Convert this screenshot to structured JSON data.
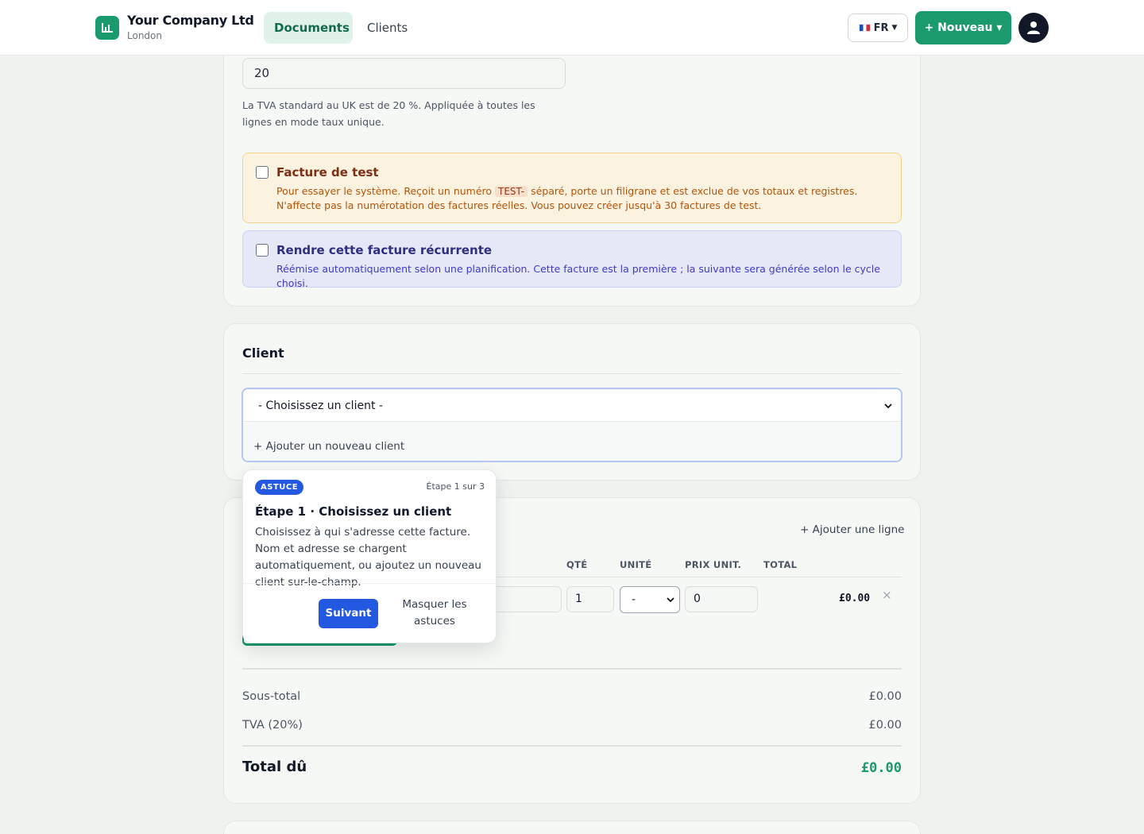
{
  "header": {
    "company_name": "Your Company Ltd",
    "company_city": "London",
    "tabs": [
      {
        "label": "Documents",
        "active": true
      },
      {
        "label": "Clients",
        "active": false
      }
    ],
    "language": "FR",
    "language_flag": "flag-fr-icon",
    "new_button": "+ Nouveau ▾"
  },
  "vat": {
    "value": "20",
    "help": "La TVA standard au UK est de 20 %. Appliquée à toutes les lignes en mode taux unique."
  },
  "test_invoice": {
    "title": "Facture de test",
    "desc_before": "Pour essayer le système. Reçoit un numéro ",
    "code": "TEST-",
    "desc_after": " séparé, porte un filigrane et est exclue de vos totaux et registres. N'affecte pas la numérotation des factures réelles. Vous pouvez créer jusqu'à 30 factures de test.",
    "checked": false
  },
  "recurring": {
    "title": "Rendre cette facture récurrente",
    "desc": "Réémise automatiquement selon une planification. Cette facture est la première ; la suivante sera générée selon le cycle choisi.",
    "checked": false
  },
  "client": {
    "section_title": "Client",
    "select_value": "- Choisissez un client -",
    "add_new": "+ Ajouter un nouveau client"
  },
  "lines": {
    "add_line": "+ Ajouter une ligne",
    "columns": [
      "QTÉ",
      "UNITÉ",
      "PRIX UNIT.",
      "TOTAL"
    ],
    "rows": [
      {
        "qty": "1",
        "unit": "-",
        "price": "0",
        "total": "£0.00"
      }
    ],
    "delete_icon": "×"
  },
  "totals": {
    "subtotal_label": "Sous-total",
    "subtotal_value": "£0.00",
    "vat_label": "TVA (20%)",
    "vat_value": "£0.00",
    "total_label": "Total dû",
    "total_value": "£0.00"
  },
  "tooltip": {
    "badge": "ASTUCE",
    "step": "Étape 1 sur 3",
    "title": "Étape 1 · Choisissez un client",
    "body": "Choisissez à qui s'adresse cette facture. Nom et adresse se chargent automatiquement, ou ajoutez un nouveau client sur-le-champ.",
    "next": "Suivant",
    "hide": "Masquer les astuces"
  },
  "colors": {
    "brand": "#1a9a6d",
    "tooltip_accent": "#2358e0",
    "test_bg": "#fbf3e0",
    "recurring_bg": "#e4e8f7"
  }
}
